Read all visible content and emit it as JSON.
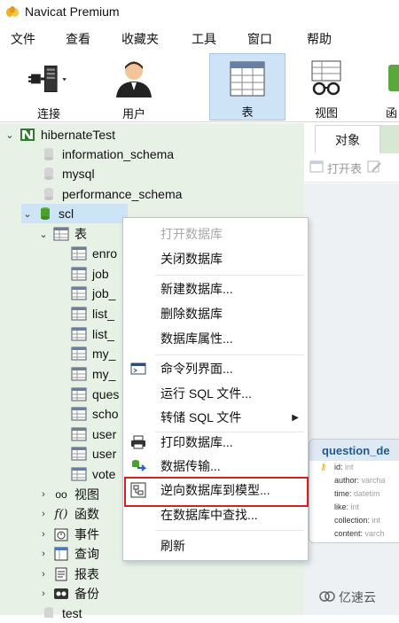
{
  "window": {
    "title": "Navicat Premium"
  },
  "menubar": {
    "items": [
      "文件",
      "查看",
      "收藏夹",
      "工具",
      "窗口",
      "帮助"
    ]
  },
  "toolbar": {
    "buttons": [
      {
        "label": "连接",
        "icon": "plug-connection-icon"
      },
      {
        "label": "用户",
        "icon": "user-icon"
      },
      {
        "label": "表",
        "icon": "table-icon",
        "active": true
      },
      {
        "label": "视图",
        "icon": "glasses-view-icon"
      },
      {
        "label": "函",
        "icon": "function-icon"
      }
    ]
  },
  "tree": {
    "connection": "hibernateTest",
    "databases": [
      "information_schema",
      "mysql",
      "performance_schema",
      "scl"
    ],
    "scl_tables_label": "表",
    "tables": [
      "enro",
      "job",
      "job_",
      "list_",
      "list_",
      "my_",
      "my_",
      "ques",
      "scho",
      "user",
      "user",
      "vote"
    ],
    "groups": [
      "视图",
      "函数",
      "事件",
      "查询",
      "报表",
      "备份"
    ],
    "last_db": "test"
  },
  "right_panel": {
    "tab_label": "对象",
    "open_table_label": "打开表",
    "card": {
      "name": "question_de",
      "fields": [
        {
          "name": "id:",
          "type": "int"
        },
        {
          "name": "author:",
          "type": "varcha"
        },
        {
          "name": "time:",
          "type": "datetim"
        },
        {
          "name": "like:",
          "type": "int"
        },
        {
          "name": "collection:",
          "type": "int"
        },
        {
          "name": "content:",
          "type": "varch"
        }
      ]
    }
  },
  "context_menu": {
    "items": [
      {
        "label": "打开数据库",
        "disabled": true
      },
      {
        "label": "关闭数据库"
      },
      {
        "label": "新建数据库..."
      },
      {
        "label": "删除数据库"
      },
      {
        "label": "数据库属性..."
      },
      {
        "label": "命令列界面...",
        "icon": "console-icon"
      },
      {
        "label": "运行 SQL 文件..."
      },
      {
        "label": "转储 SQL 文件",
        "submenu": true
      },
      {
        "label": "打印数据库...",
        "icon": "printer-icon"
      },
      {
        "label": "数据传输...",
        "icon": "data-transfer-icon"
      },
      {
        "label": "逆向数据库到模型...",
        "icon": "reverse-model-icon",
        "highlighted": true
      },
      {
        "label": "在数据库中查找..."
      },
      {
        "label": "刷新"
      }
    ]
  },
  "watermark": "亿速云",
  "colors": {
    "tree_bg": "#e7f1e6",
    "active_tool": "#cfe3f7",
    "highlight_border": "#d62020",
    "card_title": "#1e5a94"
  }
}
